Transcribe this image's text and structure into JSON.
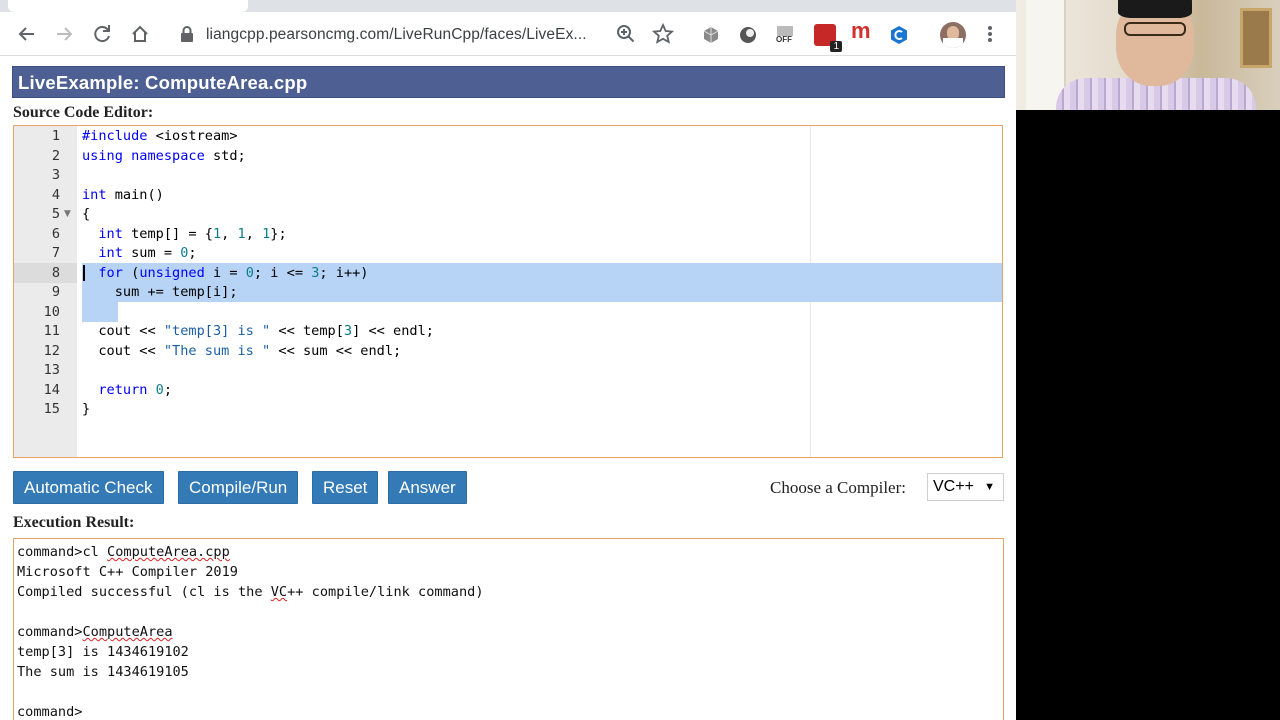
{
  "browser": {
    "url": "liangcpp.pearsoncmg.com/LiveRunCpp/faces/LiveEx...",
    "icons": [
      "back-arrow-icon",
      "forward-arrow-icon",
      "reload-icon",
      "home-icon",
      "lock-icon",
      "zoom-icon",
      "star-icon",
      "menu-icon"
    ],
    "extensions": [
      "extension-cube-icon",
      "extension-circle-icon",
      "extension-off-icon",
      "extension-badge-icon",
      "extension-m-icon",
      "extension-c-icon",
      "profile-avatar"
    ],
    "extension_off_label": "OFF",
    "extension_badge_count": "1",
    "extension_m_label": "m"
  },
  "page": {
    "title": "LiveExample: ComputeArea.cpp",
    "editor_label": "Source Code Editor:",
    "result_label": "Execution Result:"
  },
  "code": {
    "line_numbers": [
      "1",
      "2",
      "3",
      "4",
      "5",
      "6",
      "7",
      "8",
      "9",
      "10",
      "11",
      "12",
      "13",
      "14",
      "15"
    ],
    "lines": [
      "#include <iostream>",
      "using namespace std;",
      "",
      "int main()",
      "{",
      "  int temp[] = {1, 1, 1};",
      "  int sum = 0;",
      "  for (unsigned i = 0; i <= 3; i++)",
      "    sum += temp[i];",
      "",
      "  cout << \"temp[3] is \" << temp[3] << endl;",
      "  cout << \"The sum is \" << sum << endl;",
      "",
      "  return 0;",
      "}"
    ],
    "selected_lines": [
      "8",
      "9",
      "10"
    ]
  },
  "buttons": {
    "auto_check": "Automatic Check",
    "compile_run": "Compile/Run",
    "reset": "Reset",
    "answer": "Answer"
  },
  "compiler": {
    "label": "Choose a Compiler:",
    "selected": "VC++"
  },
  "output": {
    "lines": [
      "command>cl ComputeArea.cpp",
      "Microsoft C++ Compiler 2019",
      "Compiled successful (cl is the VC++ compile/link command)",
      "",
      "command>ComputeArea",
      "temp[3] is 1434619102",
      "The sum is 1434619105",
      "",
      "command>"
    ]
  },
  "colors": {
    "title_bar": "#4e5f93",
    "button": "#337ab7",
    "editor_border": "#e8a466",
    "selection": "#b7d3f5",
    "keyword": "#0000ff"
  }
}
